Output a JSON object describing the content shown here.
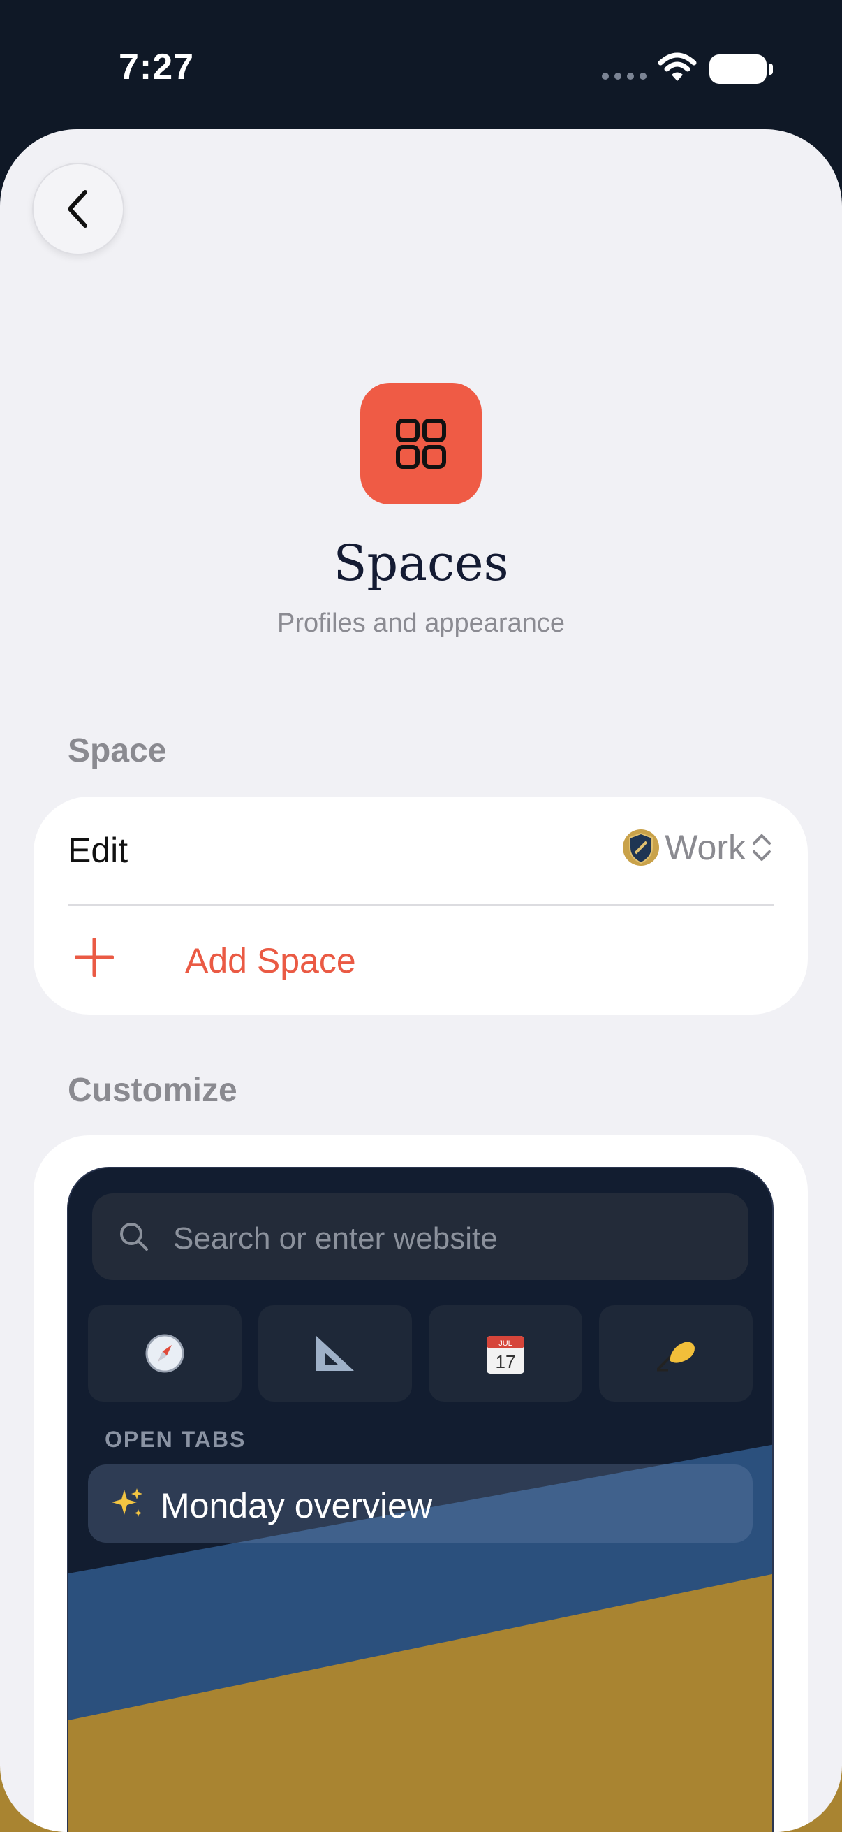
{
  "status_bar": {
    "time": "7:27"
  },
  "header": {
    "title": "Spaces",
    "subtitle": "Profiles and appearance",
    "icon": "grid-icon",
    "accent_color": "#ef5b45"
  },
  "space_section": {
    "label": "Space",
    "edit_label": "Edit",
    "current_space": "Work",
    "add_label": "Add Space"
  },
  "customize_section": {
    "label": "Customize",
    "preview": {
      "search_placeholder": "Search or enter website",
      "shortcuts": [
        "compass-icon",
        "triangle-ruler-icon",
        "calendar-icon",
        "writing-hand-icon"
      ],
      "calendar_month": "JUL",
      "calendar_day": "17",
      "open_tabs_label": "OPEN TABS",
      "tab_title": "Monday overview",
      "theme_colors": [
        "#121d30",
        "#2b507d",
        "#a98431"
      ]
    }
  }
}
